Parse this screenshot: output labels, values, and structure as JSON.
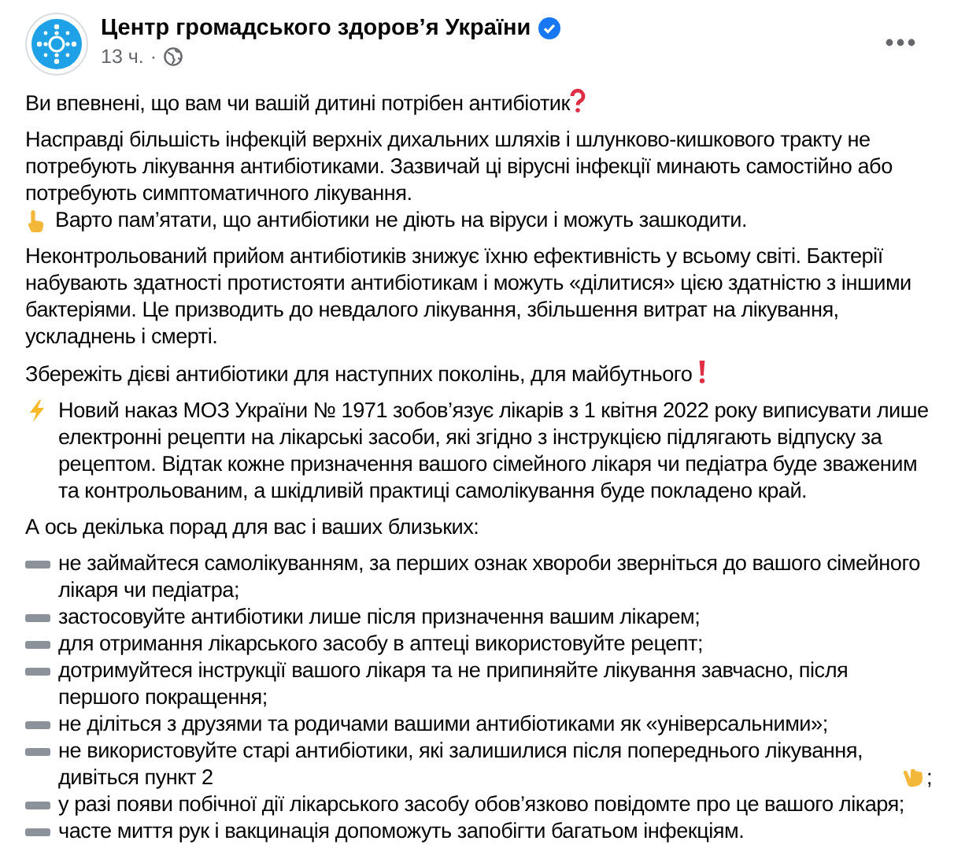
{
  "post": {
    "author": "Центр громадського здоров’я України",
    "verified": true,
    "time": "13 ч.",
    "separator": "·"
  },
  "paragraphs": [
    {
      "kind": "question",
      "text": "Ви впевнені, що вам чи вашій дитині потрібен антибіотик"
    },
    {
      "kind": "finger",
      "text": "Насправді більшість інфекцій верхніх дихальних шляхів і шлунково-кишкового тракту не потребують лікування антибіотиками. Зазвичай ці вірусні інфекції минають самостійно або потребують симптоматичного лікування.",
      "text_2": "Варто пам’ятати, що антибіотики не діють на віруси і можуть зашкодити."
    },
    {
      "kind": "plain",
      "text": "Неконтрольований прийом антибіотиків знижує їхню ефективність у всьому світі. Бактерії набувають здатності протистояти антибіотикам і можуть «ділитися» цією здатністю з іншими бактеріями. Це призводить до невдалого лікування, збільшення витрат на лікування, ускладнень і смерті."
    },
    {
      "kind": "exclaim",
      "text": "Збережіть дієві антибіотики для наступних поколінь, для майбутнього"
    },
    {
      "kind": "bolt",
      "text": "Новий наказ МОЗ України № 1971 зобов’язує лікарів з 1 квітня 2022 року виписувати лише електронні рецепти на лікарські засоби, які згідно з інструкцією підлягають відпуску за рецептом. Відтак кожне призначення вашого сімейного лікаря чи педіатра буде зваженим та контрольованим, а шкідливій практиці самолікування буде покладено край."
    },
    {
      "kind": "plain",
      "text": "А ось декілька порад для вас і ваших близьких:"
    }
  ],
  "tips": [
    {
      "kind": "plain",
      "text": "не займайтеся самолікуванням, за перших ознак хвороби зверніться до вашого сімейного лікаря чи педіатра;"
    },
    {
      "kind": "plain",
      "text": "застосовуйте антибіотики лише після призначення вашим лікарем;"
    },
    {
      "kind": "plain",
      "text": "для отримання лікарського засобу в аптеці використовуйте рецепт;"
    },
    {
      "kind": "plain",
      "text": "дотримуйтеся інструкції вашого лікаря та не припиняйте лікування завчасно, після першого покращення;"
    },
    {
      "kind": "plain",
      "text": "не діліться з друзями та родичами вашими антибіотиками як «універсальними»;"
    },
    {
      "kind": "pointer",
      "text": "не використовуйте старі антибіотики, які залишилися після попереднього лікування, дивіться пункт 2",
      "text_2": ";"
    },
    {
      "kind": "plain",
      "text": "у разі появи побічної дії лікарського засобу обов’язково повідомте про це вашого лікаря;"
    },
    {
      "kind": "plain",
      "text": "часте миття рук і вакцинація допоможуть запобігти багатьом інфекціям."
    }
  ]
}
